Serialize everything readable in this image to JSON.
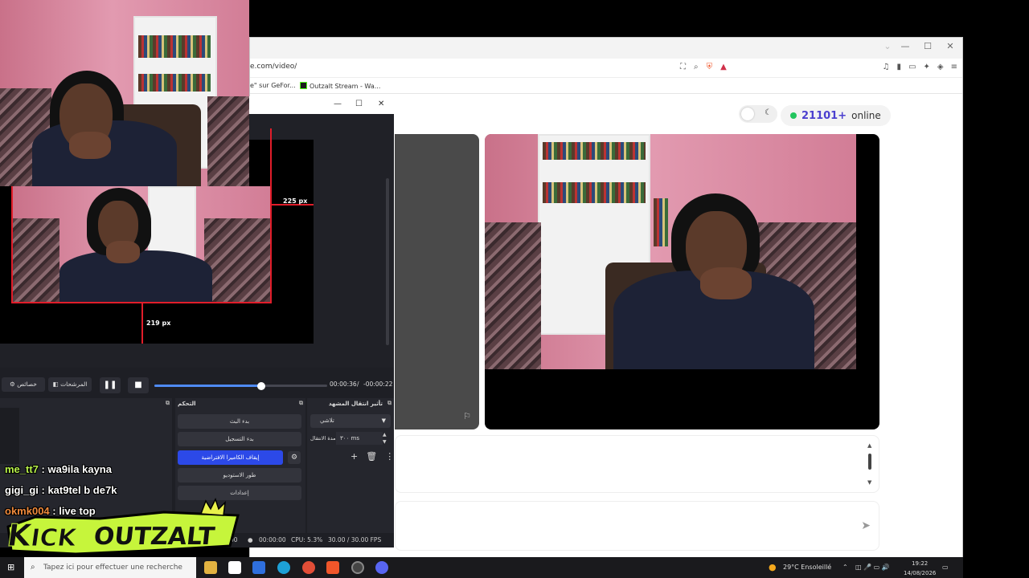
{
  "browser": {
    "url_fragment": "e.com/video/",
    "bookmarks": [
      "e\" sur GeFor...",
      "Outzalt Stream - Wa..."
    ],
    "win_controls": {
      "minimize": "—",
      "maximize": "☐",
      "close": "✕"
    }
  },
  "site": {
    "theme_toggle_icon": "moon-icon",
    "online_count": "21101+",
    "online_label": "online",
    "send_icon": "send-icon"
  },
  "obs": {
    "window_controls": {
      "minimize": "—",
      "maximize": "☐",
      "close": "✕"
    },
    "transform_labels": {
      "right": "225 px",
      "bottom": "219 px"
    },
    "controls": {
      "properties_label": "خصائص",
      "filters_label": "المرشحات",
      "time_elapsed": "00:00:36",
      "time_separator": "/",
      "time_remaining": "-00:00:22",
      "seek_progress": 0.62
    },
    "controls_dock": {
      "title": "التحكم",
      "buttons": [
        "بدء البث",
        "بدء التسجيل",
        "إيقاف الكاميرا الافتراضية",
        "طور الاستوديو",
        "إعدادات"
      ]
    },
    "transition_dock": {
      "title": "تأثير انتقال المشهد",
      "selected": "تلاشي",
      "duration_label": "مدة الانتقال",
      "duration_value": "٣٠٠ ms"
    },
    "status": {
      "rec_time": "00:00:00",
      "cpu": "CPU: 5.3%",
      "fps": "30.00 / 30.00 FPS",
      "stream_time": "00"
    }
  },
  "chat": [
    {
      "user": "me_tt7",
      "message": " : wa9ila kayna",
      "user_color": "#b8f24a"
    },
    {
      "user": "gigi_gi",
      "message": " : kat9tel b de7k",
      "user_color": "#ffffff"
    },
    {
      "user": "okmk004",
      "message": " : live top",
      "user_color": "#f08a3c"
    }
  ],
  "logo": {
    "text": "KICKOUTZALT"
  },
  "taskbar": {
    "search_placeholder": "Tapez ici pour effectuer une recherche",
    "weather": "29°C  Ensoleillé",
    "time": "19:22",
    "date": "14/08/2026"
  },
  "colors": {
    "online_count": "#4b3fcf",
    "online_dot": "#22c55e",
    "obs_active_button": "#2c49e8",
    "transform_red": "#e11d2a"
  }
}
